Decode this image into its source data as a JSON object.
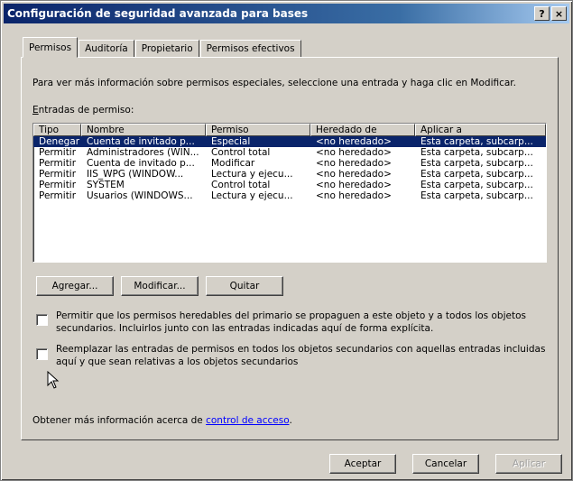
{
  "window": {
    "title": "Configuración de seguridad avanzada para bases",
    "help_button": "?",
    "close_button": "×"
  },
  "tabs": [
    {
      "label": "Permisos",
      "active": true
    },
    {
      "label": "Auditoría",
      "active": false
    },
    {
      "label": "Propietario",
      "active": false
    },
    {
      "label": "Permisos efectivos",
      "active": false
    }
  ],
  "permissions": {
    "info_text": "Para ver más información sobre permisos especiales, seleccione una entrada y haga clic en Modificar.",
    "list_label_accel": "E",
    "list_label_rest": "ntradas de permiso:",
    "columns": [
      "Tipo",
      "Nombre",
      "Permiso",
      "Heredado de",
      "Aplicar a"
    ],
    "rows": [
      [
        "Denegar",
        "Cuenta de invitado p...",
        "Especial",
        "<no heredado>",
        "Esta carpeta, subcarp..."
      ],
      [
        "Permitir",
        "Administradores (WIN...",
        "Control total",
        "<no heredado>",
        "Esta carpeta, subcarp..."
      ],
      [
        "Permitir",
        "Cuenta de invitado p...",
        "Modificar",
        "<no heredado>",
        "Esta carpeta, subcarp..."
      ],
      [
        "Permitir",
        "IIS_WPG (WINDOW...",
        "Lectura y ejecu...",
        "<no heredado>",
        "Esta carpeta, subcarp..."
      ],
      [
        "Permitir",
        "SYSTEM",
        "Control total",
        "<no heredado>",
        "Esta carpeta, subcarp..."
      ],
      [
        "Permitir",
        "Usuarios (WINDOWS...",
        "Lectura y ejecu...",
        "<no heredado>",
        "Esta carpeta, subcarp..."
      ]
    ],
    "add_button": "Agregar...",
    "edit_button": "Modificar...",
    "remove_button": "Quitar",
    "inherit_checkbox_line1": "Permitir que los permisos heredables del primario se propaguen a este objeto y a todos los objetos",
    "inherit_checkbox_line2": "secundarios. Incluirlos junto con las entradas indicadas aquí de forma explícita.",
    "replace_checkbox_line1": "Reemplazar las entradas de permisos en todos los objetos secundarios con aquellas entradas incluidas",
    "replace_checkbox_line2": "aquí y que sean relativas a los objetos secundarios",
    "more_info_prefix": "Obtener más información acerca de ",
    "more_info_link": "control de acceso",
    "more_info_suffix": "."
  },
  "footer": {
    "ok_button": "Aceptar",
    "cancel_button": "Cancelar",
    "apply_button": "Aplicar"
  },
  "colors": {
    "title_bar": "#0a246a",
    "selection": "#0a246a",
    "face": "#d4d0c8",
    "link": "#0000ff"
  }
}
